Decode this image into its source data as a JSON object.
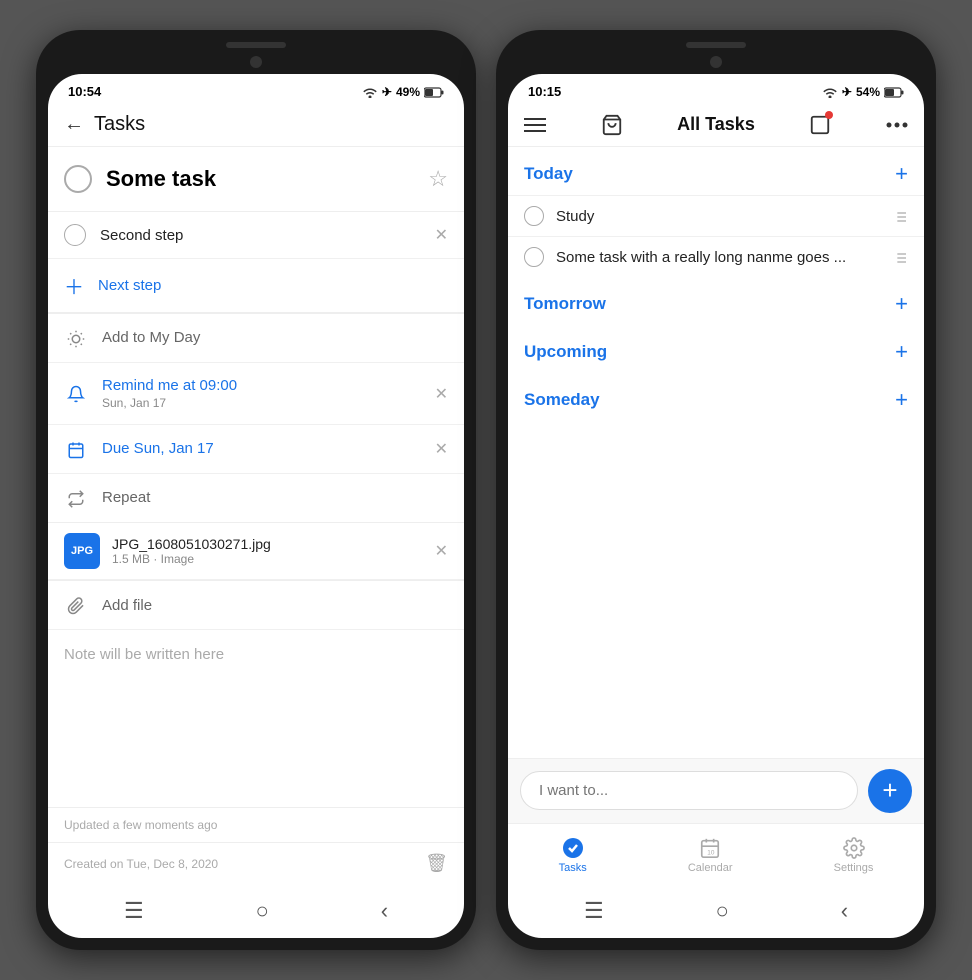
{
  "left_phone": {
    "status_time": "10:54",
    "status_battery": "49%",
    "header": {
      "back_label": "←",
      "title": "Tasks"
    },
    "task": {
      "title": "Some task",
      "star_label": "☆"
    },
    "steps": [
      {
        "text": "Second step"
      }
    ],
    "next_step_label": "Next step",
    "actions": [
      {
        "type": "add_to_day",
        "icon": "sun",
        "label": "Add to My Day"
      },
      {
        "type": "reminder",
        "icon": "bell",
        "label": "Remind me at 09:00",
        "subtitle": "Sun, Jan 17",
        "blue": true,
        "has_x": true
      },
      {
        "type": "due",
        "icon": "calendar",
        "label": "Due Sun, Jan 17",
        "blue": true,
        "has_x": true
      },
      {
        "type": "repeat",
        "icon": "repeat",
        "label": "Repeat"
      }
    ],
    "file": {
      "thumb_label": "JPG",
      "name": "JPG_1608051030271.jpg",
      "size": "1.5 MB · Image"
    },
    "add_file_label": "Add file",
    "note_placeholder": "Note will be written here",
    "updated_text": "Updated a few moments ago",
    "created_text": "Created on Tue, Dec 8, 2020"
  },
  "right_phone": {
    "status_time": "10:15",
    "status_battery": "54%",
    "header": {
      "title": "All Tasks"
    },
    "sections": [
      {
        "title": "Today",
        "items": [
          {
            "text": "Study",
            "has_subtask": true
          },
          {
            "text": "Some task with a really long nanme goes ...",
            "has_subtask": true
          }
        ]
      },
      {
        "title": "Tomorrow",
        "items": []
      },
      {
        "title": "Upcoming",
        "items": []
      },
      {
        "title": "Someday",
        "items": []
      }
    ],
    "input_placeholder": "I want to...",
    "nav_items": [
      {
        "icon": "✓",
        "label": "Tasks",
        "active": true
      },
      {
        "icon": "📅",
        "label": "Calendar",
        "active": false
      },
      {
        "icon": "⚙",
        "label": "Settings",
        "active": false
      }
    ]
  }
}
